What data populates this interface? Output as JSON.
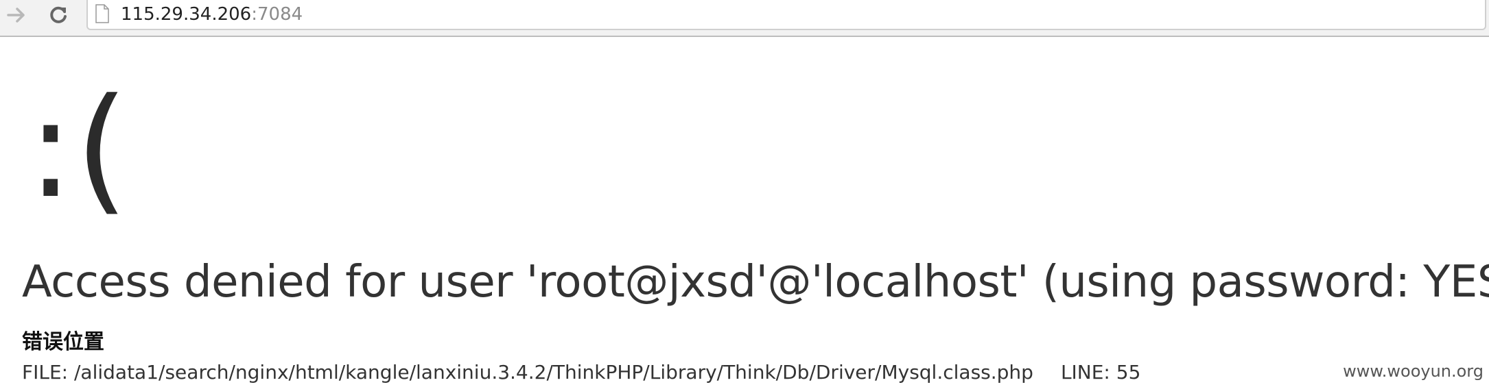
{
  "browser": {
    "url_host": "115.29.34.206",
    "url_port": ":7084",
    "icons": {
      "forward": "forward-arrow-icon",
      "reload": "reload-icon",
      "page": "page-icon"
    }
  },
  "error_page": {
    "face": ":(",
    "message": "Access denied for user 'root@jxsd'@'localhost' (using password: YES)",
    "position_title": "错误位置",
    "file_label": "FILE: ",
    "file_path": "/alidata1/search/nginx/html/kangle/lanxiniu.3.4.2/ThinkPHP/Library/Think/Db/Driver/Mysql.class.php",
    "line_label": "LINE: ",
    "line_number": "55"
  },
  "watermark": "www.wooyun.org",
  "colors": {
    "toolbar_bg": "#f2f2f2",
    "text_dark": "#333333",
    "url_port": "#8a8a8a"
  }
}
